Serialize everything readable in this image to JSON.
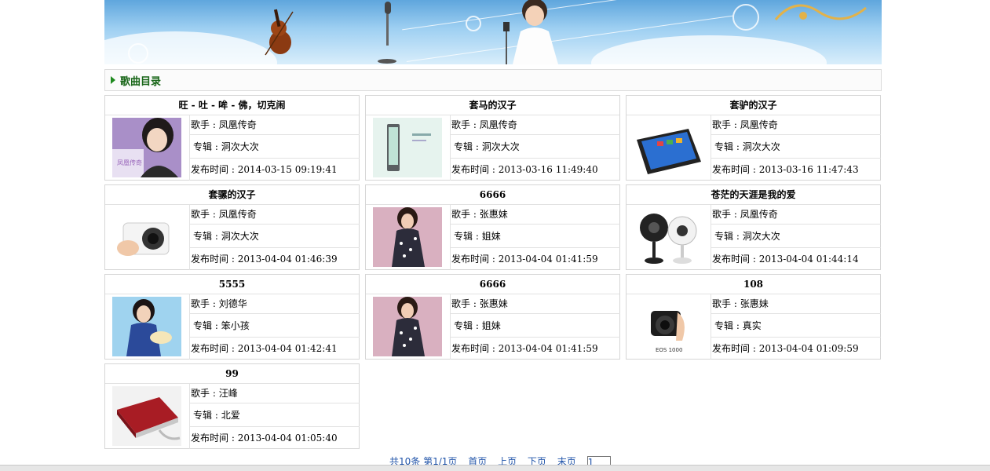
{
  "section": {
    "title": "歌曲目录"
  },
  "labels": {
    "singer": "歌手 : ",
    "album": "专辑 : ",
    "released": "发布时间 : "
  },
  "songs": [
    {
      "title": "旺 - 吐 - 哞 - 佛，切克闹",
      "singer": "凤凰传奇",
      "album": "洞次大次",
      "released": "2014-03-15 09:19:41",
      "thumb": "woman-portrait-album-cover"
    },
    {
      "title": "套马的汉子",
      "singer": "凤凰传奇",
      "album": "洞次大次",
      "released": "2013-03-16 11:49:40",
      "thumb": "phone-device"
    },
    {
      "title": "套驴的汉子",
      "singer": "凤凰传奇",
      "album": "洞次大次",
      "released": "2013-03-16 11:47:43",
      "thumb": "tablet-device"
    },
    {
      "title": "套骡的汉子",
      "singer": "凤凰传奇",
      "album": "洞次大次",
      "released": "2013-04-04 01:46:39",
      "thumb": "white-camera"
    },
    {
      "title": "6666",
      "singer": "张惠妹",
      "album": "姐妹",
      "released": "2013-04-04 01:41:59",
      "thumb": "woman-in-dress"
    },
    {
      "title": "苍茫的天涯是我的爱",
      "singer": "凤凰传奇",
      "album": "洞次大次",
      "released": "2013-04-04 01:44:14",
      "thumb": "webcams"
    },
    {
      "title": "5555",
      "singer": "刘德华",
      "album": "笨小孩",
      "released": "2013-04-04 01:42:41",
      "thumb": "woman-with-cake"
    },
    {
      "title": "6666",
      "singer": "张惠妹",
      "album": "姐妹",
      "released": "2013-04-04 01:41:59",
      "thumb": "woman-in-dress"
    },
    {
      "title": "108",
      "singer": "张惠妹",
      "album": "真实",
      "released": "2013-04-04 01:09:59",
      "thumb": "black-camera"
    },
    {
      "title": "99",
      "singer": "汪峰",
      "album": "北爱",
      "released": "2013-04-04 01:05:40",
      "thumb": "hard-drive"
    }
  ],
  "thumb_captions": {
    "album_cover": "凤凰传奇",
    "camera_model": "EOS 1000"
  },
  "pager": {
    "summary": "共10条 第1/1页",
    "first": "首页",
    "prev": "上页",
    "next": "下页",
    "last": "末页",
    "page_value": "1"
  }
}
